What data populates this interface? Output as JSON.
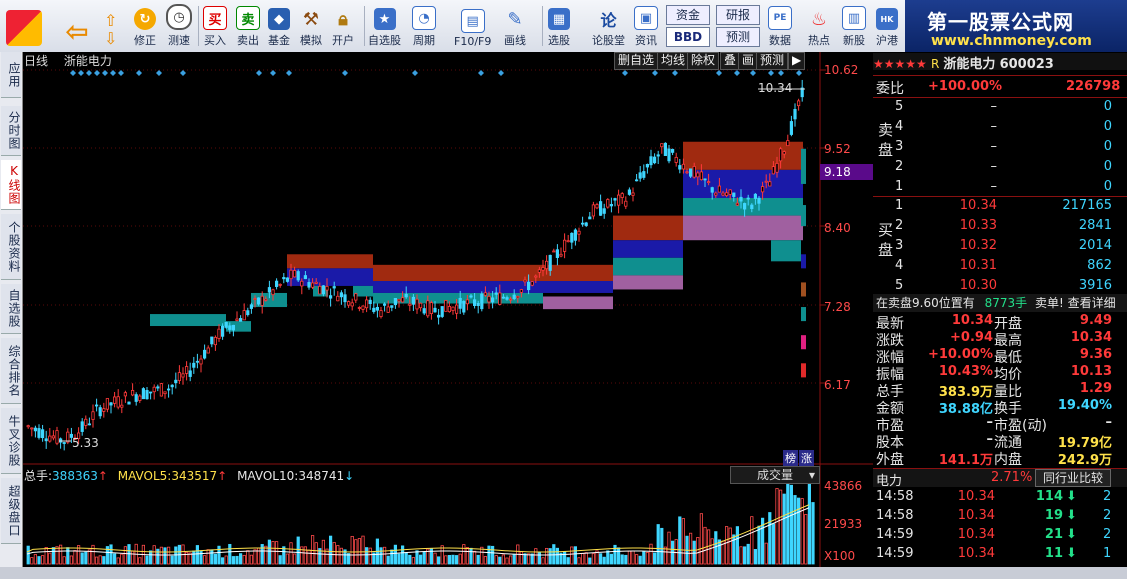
{
  "toolbar": {
    "buttons": [
      "修正",
      "测速",
      "买入",
      "卖出",
      "基金",
      "模拟",
      "开户",
      "自选股",
      "周期",
      "F10/F9",
      "画线",
      "选股",
      "论股堂",
      "资讯",
      "数据",
      "热点",
      "新股",
      "沪港"
    ],
    "top_pills": {
      "zijin": "资金",
      "yanbao": "研报",
      "bbd": "BBD",
      "yuce": "预测"
    }
  },
  "brand": {
    "title": "第一股票公式网",
    "url": "www.chnmoney.com"
  },
  "side_tabs": [
    "应用",
    "分时图",
    "K线图",
    "个股资料",
    "自选股",
    "综合排名",
    "牛叉诊股",
    "超级盘口"
  ],
  "chart": {
    "period": "日线",
    "name": "浙能电力",
    "controls": [
      "删自选",
      "均线",
      "除权",
      "叠",
      "画",
      "预测"
    ],
    "price_axis": [
      "10.62",
      "9.52",
      "9.18",
      "8.40",
      "7.28",
      "6.17"
    ],
    "current_label": "9.18",
    "high_mark": "10.34",
    "low_mark": "5.33",
    "tag_bang": "榜",
    "tag_zhang": "涨"
  },
  "volume": {
    "total_label": "总手:",
    "total": "388363",
    "mav5_label": "MAVOL5:",
    "mav5": "343517",
    "mav10_label": "MAVOL10:",
    "mav10": "348741",
    "dropdown": "成交量",
    "axis": [
      "43866",
      "21933",
      "X100"
    ]
  },
  "quote": {
    "stars": "★★★★★",
    "r": "R",
    "name": "浙能电力",
    "code": "600023",
    "weibi_label": "委比",
    "weibi": "+100.00%",
    "weicha": "226798",
    "sell_label": "卖盘",
    "buy_label": "买盘",
    "sell": [
      {
        "n": "5",
        "p": "–",
        "v": "0"
      },
      {
        "n": "4",
        "p": "–",
        "v": "0"
      },
      {
        "n": "3",
        "p": "–",
        "v": "0"
      },
      {
        "n": "2",
        "p": "–",
        "v": "0"
      },
      {
        "n": "1",
        "p": "–",
        "v": "0"
      }
    ],
    "buy": [
      {
        "n": "1",
        "p": "10.34",
        "v": "217165"
      },
      {
        "n": "2",
        "p": "10.33",
        "v": "2841"
      },
      {
        "n": "3",
        "p": "10.32",
        "v": "2014"
      },
      {
        "n": "4",
        "p": "10.31",
        "v": "862"
      },
      {
        "n": "5",
        "p": "10.30",
        "v": "3916"
      }
    ],
    "notice": "在卖盘9.60位置有",
    "notice_vol": "8773手",
    "notice_tail": "卖单! 查看详细",
    "stats": [
      {
        "l": "最新",
        "v": "10.34",
        "l2": "开盘",
        "v2": "9.49"
      },
      {
        "l": "涨跌",
        "v": "+0.94",
        "l2": "最高",
        "v2": "10.34"
      },
      {
        "l": "涨幅",
        "v": "+10.00%",
        "l2": "最低",
        "v2": "9.36"
      },
      {
        "l": "振幅",
        "v": "10.43%",
        "l2": "均价",
        "v2": "10.13"
      },
      {
        "l": "总手",
        "v": "383.9万",
        "l2": "量比",
        "v2": "1.29"
      },
      {
        "l": "金额",
        "v": "38.88亿",
        "l2": "换手",
        "v2": "19.40%"
      },
      {
        "l": "市盈",
        "v": "–",
        "l2": "市盈(动)",
        "v2": "–"
      },
      {
        "l": "股本",
        "v": "–",
        "l2": "流通",
        "v2": "19.79亿"
      },
      {
        "l": "外盘",
        "v": "141.1万",
        "l2": "内盘",
        "v2": "242.9万"
      }
    ],
    "sector": "电力",
    "sector_pct": "2.71%",
    "peer_btn": "同行业比较",
    "ticks": [
      {
        "t": "14:58",
        "p": "10.34",
        "v": "114",
        "n": "2"
      },
      {
        "t": "14:58",
        "p": "10.34",
        "v": "19",
        "n": "2"
      },
      {
        "t": "14:59",
        "p": "10.34",
        "v": "21",
        "n": "2"
      },
      {
        "t": "14:59",
        "p": "10.34",
        "v": "11",
        "n": "1"
      }
    ]
  }
}
